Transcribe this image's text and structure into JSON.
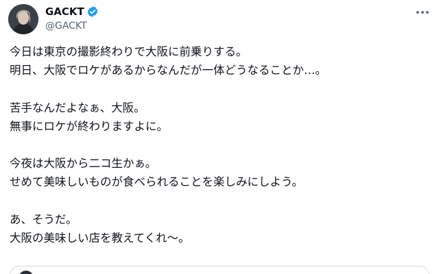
{
  "author": {
    "display_name": "GACKT",
    "handle": "@GACKT",
    "verified": true,
    "avatar_icon": "avatar-portrait",
    "verified_color": "#1d9bf0"
  },
  "menu": {
    "icon": "more-horizontal-icon"
  },
  "tweet": {
    "lines": [
      "今日は東京の撮影終わりで大阪に前乗りする。",
      "明日、大阪でロケがあるからなんだが一体どうなることか…。",
      "",
      "苦手なんだよなぁ、大阪。",
      "無事にロケが終わりますよに。",
      "",
      "今夜は大阪から二コ生かぁ。",
      "せめて美味しいものが食べられることを楽しみにしよう。",
      "",
      "あ、そうだ。",
      "大阪の美味しい店を教えてくれ〜。"
    ]
  },
  "colors": {
    "text": "#0f1419",
    "secondary": "#536471",
    "border": "#cfd9de"
  }
}
